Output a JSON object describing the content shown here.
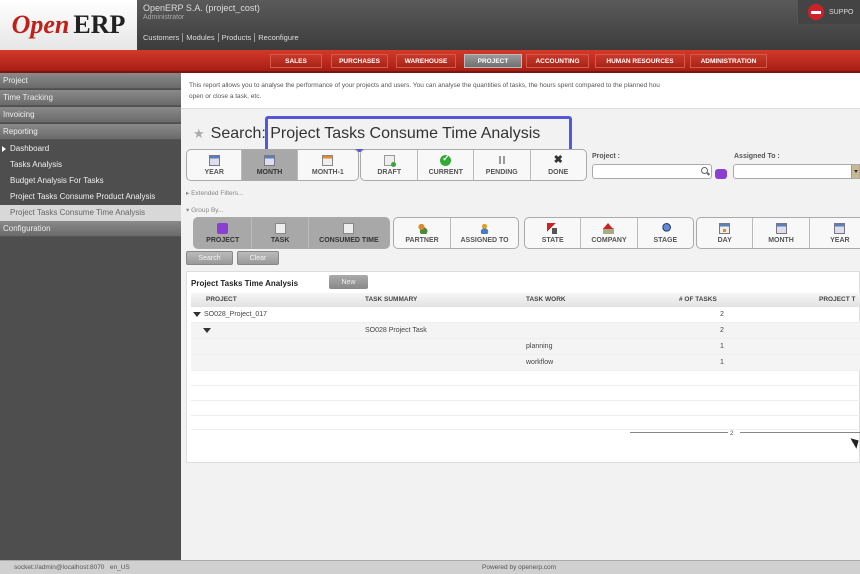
{
  "header": {
    "logo_open": "Open",
    "logo_erp": "ERP",
    "company": "OpenERP S.A. (project_cost)",
    "user": "Administrator",
    "links": [
      "Customers",
      "Modules",
      "Products",
      "Reconfigure"
    ],
    "support_label": "SUPPO"
  },
  "menu": {
    "tabs": [
      "SALES",
      "PURCHASES",
      "WAREHOUSE",
      "PROJECT",
      "ACCOUNTING",
      "HUMAN RESOURCES",
      "ADMINISTRATION"
    ],
    "active": "PROJECT"
  },
  "sidebar": {
    "sections": [
      "Project",
      "Time Tracking",
      "Invoicing",
      "Reporting"
    ],
    "reporting_items": [
      "Dashboard",
      "Tasks Analysis",
      "Budget Analysis For Tasks",
      "Project Tasks Consume Product Analysis",
      "Project Tasks Consume Time Analysis"
    ],
    "selected_item": "Project Tasks Consume Time Analysis",
    "bottom_section": "Configuration"
  },
  "main": {
    "help_text": "This report allows you to analyse the performance of your projects and users. You can analyse the quantities of tasks, the hours spent compared to the planned hours ... open or close a task, etc.",
    "help_line1": "This report allows you to analyse the performance of your projects and users. You can analyse the quantities of tasks, the hours spent compared to the planned hou",
    "help_line2": "open or close a task, etc.",
    "title": "Search: Project Tasks Consume Time Analysis",
    "filters_date": [
      {
        "label": "YEAR",
        "icon": "calendar-icon",
        "active": false
      },
      {
        "label": "MONTH",
        "icon": "calendar-icon",
        "active": true
      },
      {
        "label": "MONTH-1",
        "icon": "calendar-icon",
        "active": false
      }
    ],
    "filters_state": [
      {
        "label": "DRAFT",
        "icon": "draft-icon"
      },
      {
        "label": "CURRENT",
        "icon": "check-icon"
      },
      {
        "label": "PENDING",
        "icon": "pause-icon"
      },
      {
        "label": "DONE",
        "icon": "close-icon"
      }
    ],
    "project_label": "Project :",
    "project_value": "",
    "assigned_label": "Assigned To :",
    "assigned_value": "",
    "extended_filters": "Extended Filters...",
    "group_by": "Group By...",
    "group_set1": [
      {
        "label": "PROJECT",
        "icon": "folder-icon",
        "active": true
      },
      {
        "label": "TASK",
        "icon": "task-icon",
        "active": true
      },
      {
        "label": "CONSUMED TIME",
        "icon": "task-icon",
        "active": true
      }
    ],
    "group_set2": [
      {
        "label": "PARTNER",
        "icon": "partner-icon"
      },
      {
        "label": "ASSIGNED TO",
        "icon": "user-icon"
      }
    ],
    "group_set3": [
      {
        "label": "STATE",
        "icon": "state-icon"
      },
      {
        "label": "COMPANY",
        "icon": "company-icon"
      },
      {
        "label": "STAGE",
        "icon": "stage-icon"
      }
    ],
    "group_set4": [
      {
        "label": "DAY",
        "icon": "calendar-icon"
      },
      {
        "label": "MONTH",
        "icon": "calendar-icon"
      },
      {
        "label": "YEAR",
        "icon": "calendar-icon"
      }
    ],
    "search_button": "Search",
    "clear_button": "Clear"
  },
  "list": {
    "title": "Project Tasks Time Analysis",
    "new_button": "New",
    "columns": [
      "PROJECT",
      "TASK SUMMARY",
      "TASK WORK",
      "# OF TASKS",
      "PROJECT T"
    ],
    "rows": [
      {
        "project": "SO028_Project_017",
        "task_summary": "",
        "task_work": "",
        "num_tasks": "2",
        "level": 0
      },
      {
        "project": "",
        "task_summary": "SO028 Project Task",
        "task_work": "",
        "num_tasks": "2",
        "level": 1
      },
      {
        "project": "",
        "task_summary": "",
        "task_work": "planning",
        "num_tasks": "1",
        "level": 2
      },
      {
        "project": "",
        "task_summary": "",
        "task_work": "workflow",
        "num_tasks": "1",
        "level": 2
      }
    ],
    "total": "2"
  },
  "statusbar": {
    "socket": "socket://admin@localhost:8070",
    "lang": "en_US",
    "powered": "Powered by openerp.com"
  },
  "colors": {
    "brand_red": "#c0201a",
    "highlight_box": "#5457d8"
  }
}
